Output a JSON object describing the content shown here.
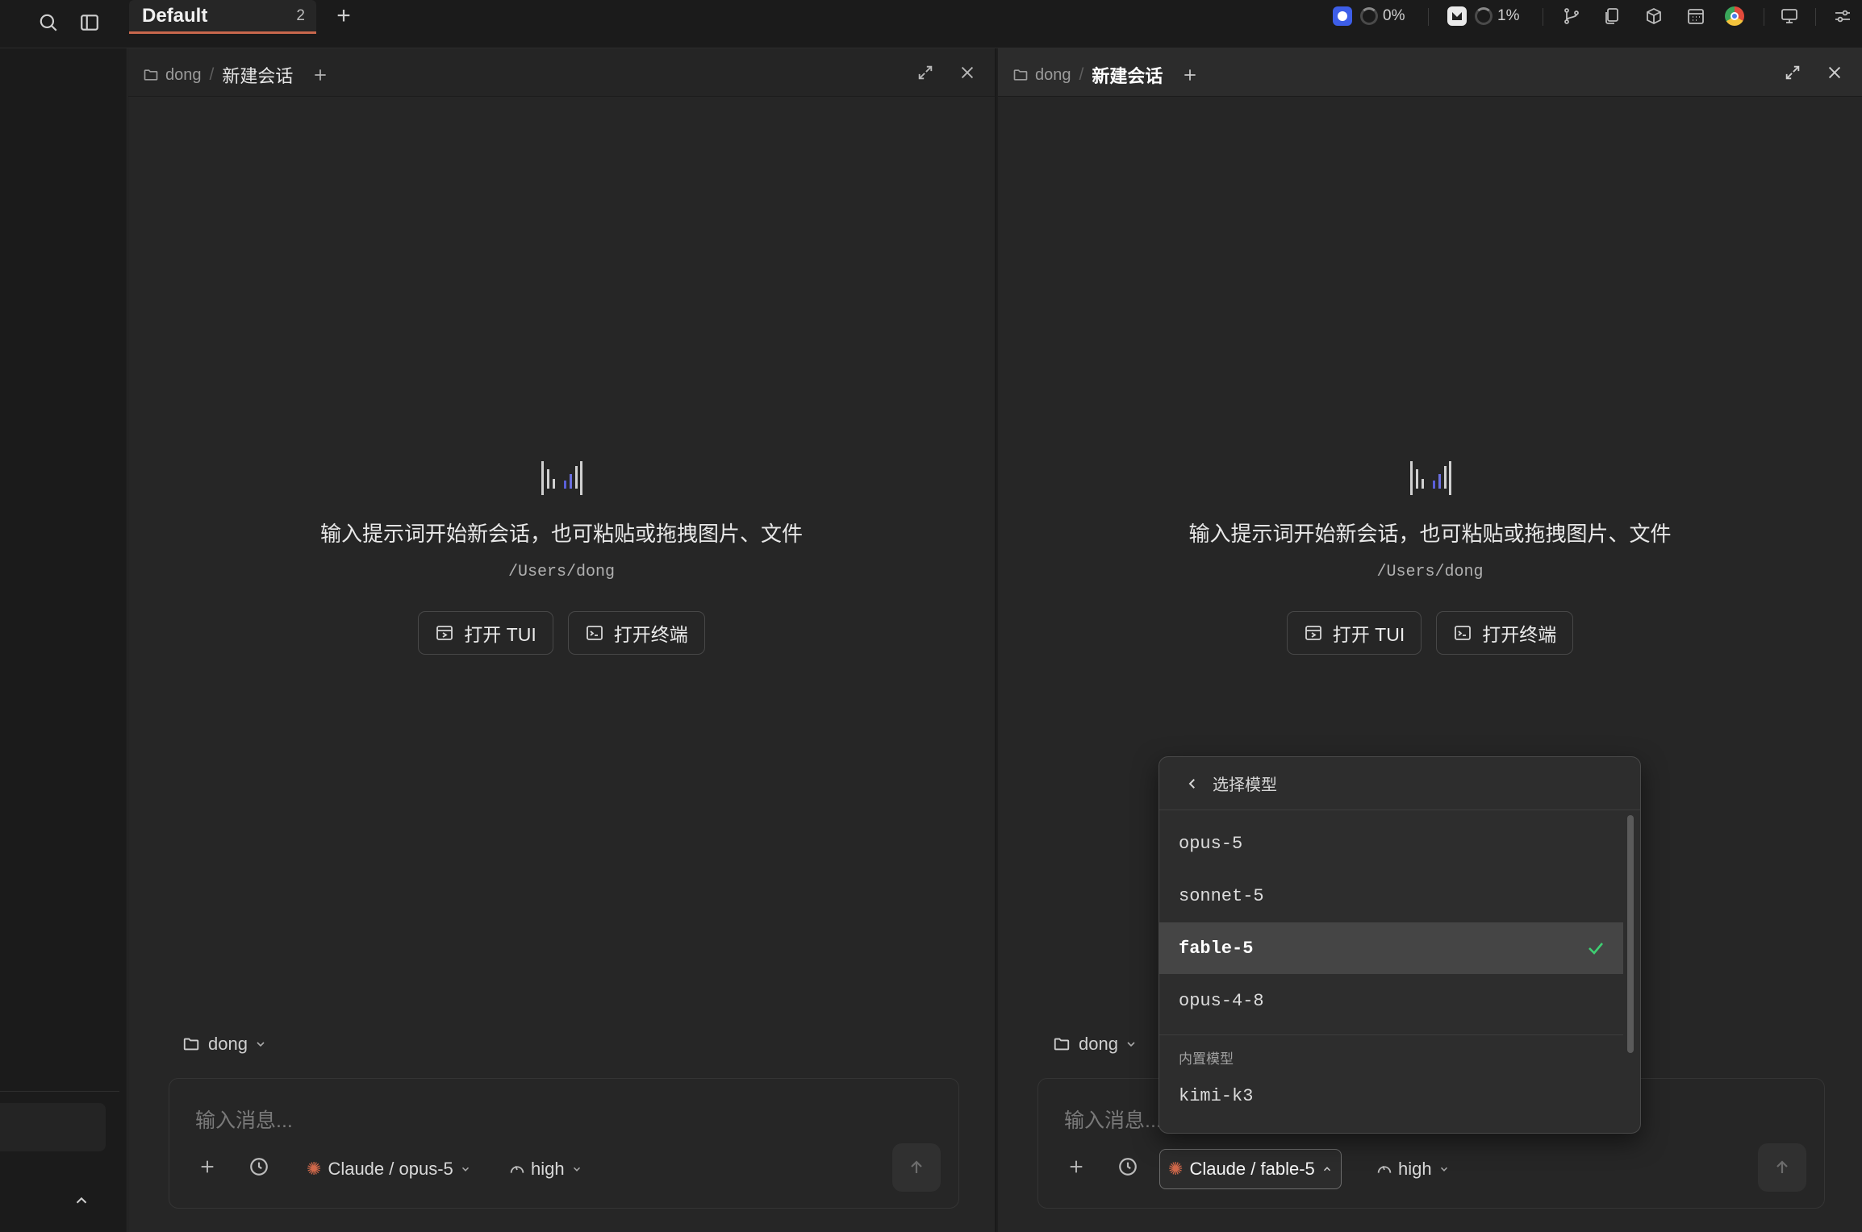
{
  "workspace_tab": {
    "name": "Default",
    "count": "2",
    "new_tab": "+"
  },
  "status": {
    "cpu_1": "0%",
    "cpu_2": "1%"
  },
  "panes": [
    {
      "folder": "dong",
      "title": "新建会话",
      "empty_hint": "输入提示词开始新会话，也可粘贴或拖拽图片、文件",
      "path": "/Users/dong",
      "open_tui": "打开 TUI",
      "open_terminal": "打开终端",
      "folder_chip": "dong",
      "input_placeholder": "输入消息...",
      "model": "Claude / opus-5",
      "effort": "high"
    },
    {
      "folder": "dong",
      "title": "新建会话",
      "empty_hint": "输入提示词开始新会话，也可粘贴或拖拽图片、文件",
      "path": "/Users/dong",
      "open_tui": "打开 TUI",
      "open_terminal": "打开终端",
      "folder_chip": "dong",
      "input_placeholder": "输入消息...",
      "model": "Claude / fable-5",
      "effort": "high"
    }
  ],
  "model_dropdown": {
    "title": "选择模型",
    "items": [
      "opus-5",
      "sonnet-5",
      "fable-5",
      "opus-4-8"
    ],
    "selected": "fable-5",
    "section_label": "内置模型",
    "builtin_items": [
      "kimi-k3"
    ]
  },
  "colors": {
    "accent": "#c8674c",
    "check": "#3ecf72",
    "claude_star": "#d0684a"
  }
}
